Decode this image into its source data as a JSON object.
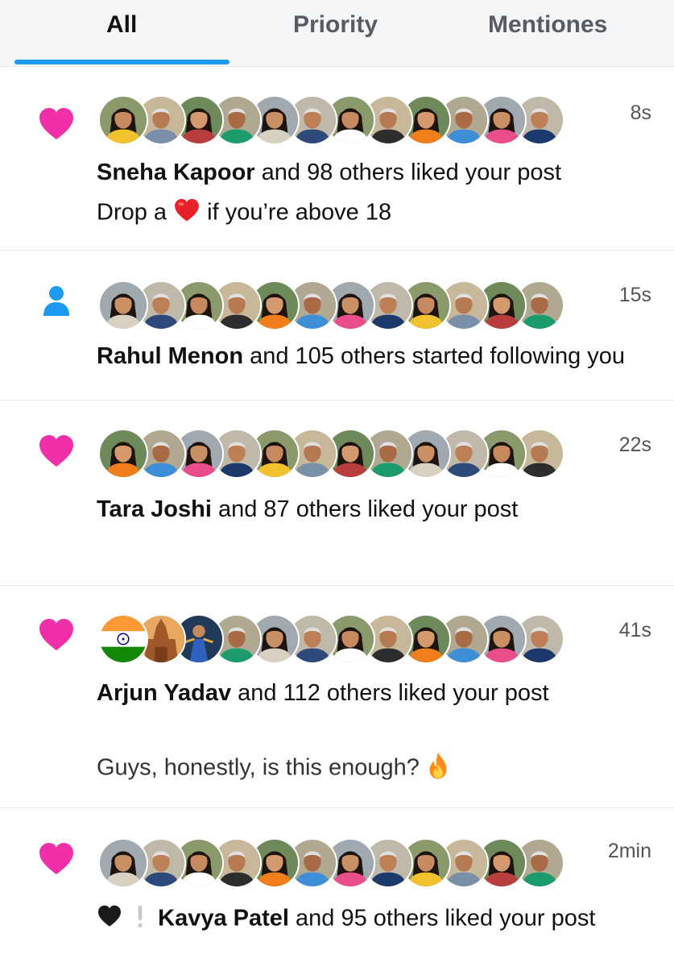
{
  "tabs": [
    {
      "label": "All",
      "active": true
    },
    {
      "label": "Priority",
      "active": false
    },
    {
      "label": "Mentiones",
      "active": false
    }
  ],
  "colors": {
    "accent": "#1d9bf0",
    "like": "#f02fa8",
    "follow": "#1d9bf0"
  },
  "notifications": [
    {
      "type_icon": "heart-icon",
      "time": "8s",
      "name": "Sneha Kapoor",
      "action": " and 98 others liked your post",
      "message_before": "Drop a ",
      "message_emoji": "red-heart-emoji",
      "message_after": " if you’re above 18"
    },
    {
      "type_icon": "person-icon",
      "time": "15s",
      "name": "Rahul Menon",
      "action": " and 105 others started following you"
    },
    {
      "type_icon": "heart-icon",
      "time": "22s",
      "name": "Tara Joshi",
      "action": " and 87 others liked your post"
    },
    {
      "type_icon": "heart-icon",
      "time": "41s",
      "name": "Arjun Yadav",
      "action": " and 112 others liked your post",
      "message": "Guys, honestly, is this enough? ",
      "message_emoji": "fire-emoji"
    },
    {
      "type_icon": "heart-icon",
      "time": "2min",
      "name": "Kavya Patel",
      "action": " and 95 others liked your post",
      "prefix_emojis": [
        "black-heart-emoji",
        "exclamation-emoji"
      ]
    }
  ]
}
